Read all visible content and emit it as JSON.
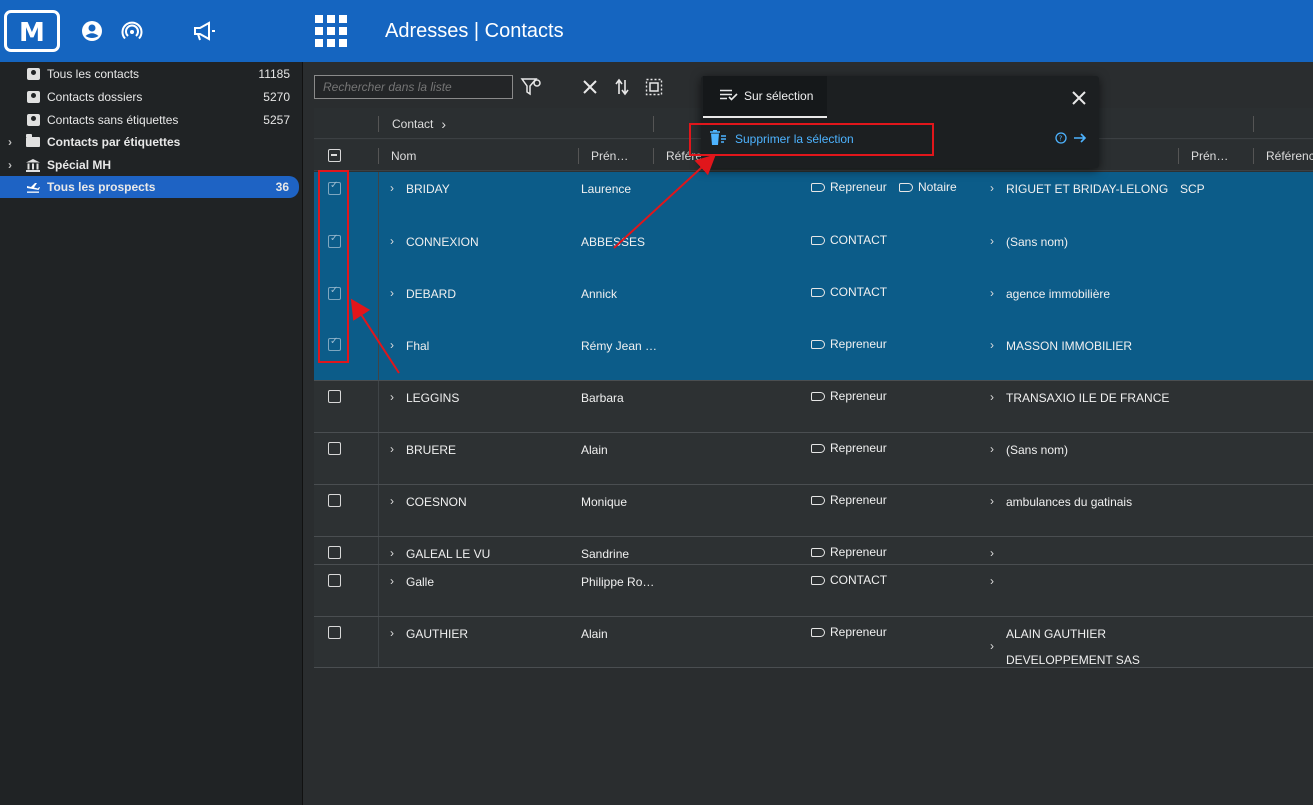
{
  "header": {
    "app_title": "Adresses | Contacts",
    "logo_letter": "M",
    "brand_color": "#1565c0"
  },
  "sidebar": {
    "items": [
      {
        "label": "Tous les contacts",
        "count": "11185",
        "icon": "contact-card-icon"
      },
      {
        "label": "Contacts dossiers",
        "count": "5270",
        "icon": "contact-card-icon"
      },
      {
        "label": "Contacts sans étiquettes",
        "count": "5257",
        "icon": "contact-card-icon"
      },
      {
        "label": "Contacts par étiquettes",
        "count": "",
        "icon": "folder-icon"
      },
      {
        "label": "Spécial MH",
        "count": "",
        "icon": "bank-icon"
      },
      {
        "label": "Tous les prospects",
        "count": "36",
        "icon": "airplane-icon"
      }
    ]
  },
  "toolbar": {
    "search_placeholder": "Rechercher dans la liste"
  },
  "grid": {
    "group_headers": {
      "contact": "Contact"
    },
    "columns": {
      "nom": "Nom",
      "prenom": "Prén…",
      "reference": "Référe",
      "prenom2": "Prén…",
      "reference2": "Référenc"
    },
    "rows": [
      {
        "nom": "BRIDAY",
        "prenom": "Laurence",
        "tags": [
          "Repreneur",
          "Notaire"
        ],
        "societe": "RIGUET ET BRIDAY-LELONG",
        "extra": "SCP",
        "selected": true
      },
      {
        "nom": "CONNEXION",
        "prenom": "ABBESSES",
        "tags": [
          "CONTACT"
        ],
        "societe": "(Sans nom)",
        "extra": "",
        "selected": true
      },
      {
        "nom": "DEBARD",
        "prenom": "Annick",
        "tags": [
          "CONTACT"
        ],
        "societe": "agence immobilière",
        "extra": "",
        "selected": true
      },
      {
        "nom": "Fhal",
        "prenom": "Rémy Jean …",
        "tags": [
          "Repreneur"
        ],
        "societe": "MASSON IMMOBILIER",
        "extra": "",
        "selected": true
      },
      {
        "nom": "LEGGINS",
        "prenom": "Barbara",
        "tags": [
          "Repreneur"
        ],
        "societe": "TRANSAXIO ILE DE FRANCE",
        "extra": "",
        "selected": false
      },
      {
        "nom": "BRUERE",
        "prenom": "Alain",
        "tags": [
          "Repreneur"
        ],
        "societe": "(Sans nom)",
        "extra": "",
        "selected": false
      },
      {
        "nom": "COESNON",
        "prenom": "Monique",
        "tags": [
          "Repreneur"
        ],
        "societe": "ambulances du gatinais",
        "extra": "",
        "selected": false
      },
      {
        "nom": "GALEAL LE VU",
        "prenom": "Sandrine",
        "tags": [
          "Repreneur"
        ],
        "societe": "",
        "extra": "",
        "selected": false
      },
      {
        "nom": "Galle",
        "prenom": "Philippe Ro…",
        "tags": [
          "CONTACT"
        ],
        "societe": "",
        "extra": "",
        "selected": false
      },
      {
        "nom": "GAUTHIER",
        "prenom": "Alain",
        "tags": [
          "Repreneur"
        ],
        "societe": "ALAIN GAUTHIER",
        "societe_line2": "DEVELOPPEMENT SAS",
        "extra": "",
        "selected": false
      }
    ]
  },
  "popup": {
    "tab_label": "Sur sélection",
    "action_label": "Supprimer la sélection"
  }
}
